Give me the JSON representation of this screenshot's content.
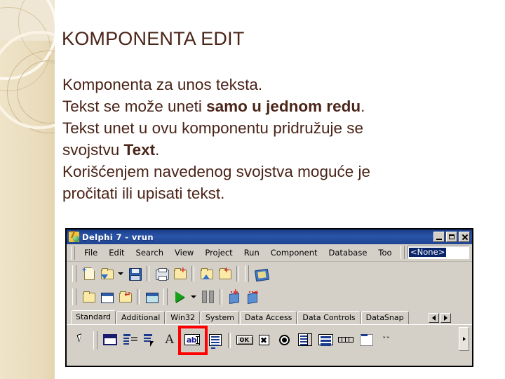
{
  "slide": {
    "title": "KOMPONENTA EDIT",
    "title_color": "#4a2418",
    "accent_band_color": "#e9dcbc",
    "body_lines": [
      {
        "parts": [
          {
            "t": "Komponenta za unos teksta.",
            "b": false
          }
        ]
      },
      {
        "parts": [
          {
            "t": "Tekst se može uneti ",
            "b": false
          },
          {
            "t": "samo u jednom redu",
            "b": true
          },
          {
            "t": ".",
            "b": false
          }
        ]
      },
      {
        "parts": [
          {
            "t": "Tekst unet u ovu komponentu pridružuje se",
            "b": false
          }
        ]
      },
      {
        "parts": [
          {
            "t": "svojstvu ",
            "b": false
          },
          {
            "t": "Text",
            "b": true
          },
          {
            "t": ".",
            "b": false
          }
        ]
      },
      {
        "parts": [
          {
            "t": "Korišćenjem navedenog svojstva moguće je",
            "b": false
          }
        ]
      },
      {
        "parts": [
          {
            "t": "pročitati ili upisati tekst.",
            "b": false
          }
        ]
      }
    ]
  },
  "delphi": {
    "window_title": "Delphi 7 - vrun",
    "titlebar_color": "#1f4391",
    "chrome_color": "#d4d0c8",
    "window_buttons": [
      {
        "name": "minimize",
        "label": "_"
      },
      {
        "name": "maximize",
        "label": "□"
      },
      {
        "name": "close",
        "label": "✕"
      }
    ],
    "menu": [
      "File",
      "Edit",
      "Search",
      "View",
      "Project",
      "Run",
      "Component",
      "Database",
      "Too"
    ],
    "project_combo": {
      "value": "<None>",
      "highlight_color": "#0a246a"
    },
    "toolbar_row1": [
      "new-item-icon",
      "open-project-icon",
      "open-dropdown-icon",
      "save-icon",
      "print-icon",
      "save-all-icon",
      "open-file-icon",
      "add-to-project-icon",
      "help-icon"
    ],
    "toolbar_row2": [
      "view-unit-icon",
      "view-form-icon",
      "toggle-form-unit-icon",
      "new-form-icon",
      "run-icon",
      "run-dropdown-icon",
      "pause-icon",
      "trace-into-icon",
      "step-over-icon"
    ],
    "palette_tabs": [
      {
        "label": "Standard",
        "active": true
      },
      {
        "label": "Additional",
        "active": false
      },
      {
        "label": "Win32",
        "active": false
      },
      {
        "label": "System",
        "active": false
      },
      {
        "label": "Data Access",
        "active": false
      },
      {
        "label": "Data Controls",
        "active": false
      },
      {
        "label": "DataSnap",
        "active": false
      }
    ],
    "palette_components": [
      {
        "name": "pointer-tool",
        "glyph": "cursor"
      },
      {
        "name": "frames-component",
        "glyph": "frame"
      },
      {
        "name": "mainmenu-component",
        "glyph": "mainmenu"
      },
      {
        "name": "popupmenu-component",
        "glyph": "popupmenu"
      },
      {
        "name": "label-component",
        "glyph": "label-A"
      },
      {
        "name": "edit-component",
        "glyph": "edit-ab",
        "highlighted": true,
        "highlight_color": "#ff0000"
      },
      {
        "name": "memo-component",
        "glyph": "memo"
      },
      {
        "name": "button-component",
        "glyph": "ok-button",
        "text": "OK"
      },
      {
        "name": "checkbox-component",
        "glyph": "checkbox",
        "text": "✖"
      },
      {
        "name": "radiobutton-component",
        "glyph": "radio"
      },
      {
        "name": "listbox-component",
        "glyph": "listbox"
      },
      {
        "name": "combobox-component",
        "glyph": "combobox"
      },
      {
        "name": "scrollbar-component",
        "glyph": "scrollbar"
      },
      {
        "name": "groupbox-component",
        "glyph": "groupbox"
      },
      {
        "name": "radiogroup-component",
        "glyph": "chevron-down",
        "text": "ˇˇ"
      }
    ],
    "palette_scroll_arrows": {
      "left": "◄",
      "right": "►"
    },
    "palette_overflow": {
      "right": "►"
    }
  }
}
